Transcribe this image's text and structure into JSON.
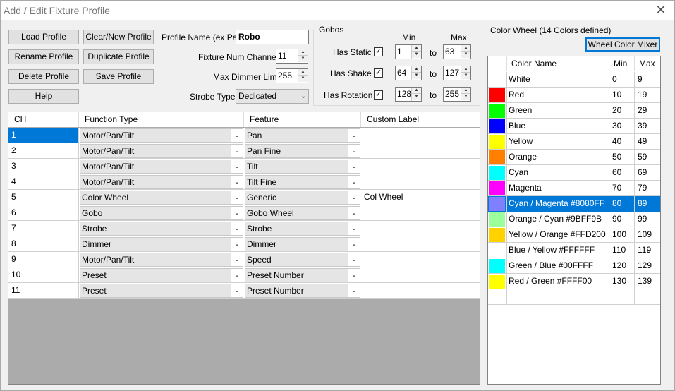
{
  "window": {
    "title": "Add / Edit Fixture Profile",
    "close_glyph": "✕"
  },
  "buttons": {
    "load_profile": "Load Profile",
    "clear_new_profile": "Clear/New Profile",
    "rename_profile": "Rename Profile",
    "duplicate_profile": "Duplicate Profile",
    "delete_profile": "Delete Profile",
    "save_profile": "Save Profile",
    "help": "Help",
    "wheel_color_mixer": "Wheel Color Mixer"
  },
  "profile": {
    "name_label": "Profile Name (ex Par)",
    "name_value": "Robo",
    "num_channels_label": "Fixture Num Channels",
    "num_channels_value": "11",
    "max_dimmer_label": "Max Dimmer Limit",
    "max_dimmer_value": "255",
    "strobe_type_label": "Strobe Type",
    "strobe_type_value": "Dedicated"
  },
  "gobos": {
    "title": "Gobos",
    "min_header": "Min",
    "max_header": "Max",
    "to_label": "to",
    "rows": [
      {
        "label": "Has Static",
        "checked": "✓",
        "min": "1",
        "max": "63"
      },
      {
        "label": "Has Shake",
        "checked": "✓",
        "min": "64",
        "max": "127"
      },
      {
        "label": "Has Rotation",
        "checked": "✓",
        "min": "128",
        "max": "255"
      }
    ]
  },
  "grid": {
    "headers": [
      "CH",
      "Function Type",
      "Feature",
      "Custom Label"
    ],
    "rows": [
      {
        "ch": "1",
        "function": "Motor/Pan/Tilt",
        "feature": "Pan",
        "label": ""
      },
      {
        "ch": "2",
        "function": "Motor/Pan/Tilt",
        "feature": "Pan Fine",
        "label": ""
      },
      {
        "ch": "3",
        "function": "Motor/Pan/Tilt",
        "feature": "Tilt",
        "label": ""
      },
      {
        "ch": "4",
        "function": "Motor/Pan/Tilt",
        "feature": "Tilt Fine",
        "label": ""
      },
      {
        "ch": "5",
        "function": "Color Wheel",
        "feature": "Generic",
        "label": "Col Wheel"
      },
      {
        "ch": "6",
        "function": "Gobo",
        "feature": "Gobo Wheel",
        "label": ""
      },
      {
        "ch": "7",
        "function": "Strobe",
        "feature": "Strobe",
        "label": ""
      },
      {
        "ch": "8",
        "function": "Dimmer",
        "feature": "Dimmer",
        "label": ""
      },
      {
        "ch": "9",
        "function": "Motor/Pan/Tilt",
        "feature": "Speed",
        "label": ""
      },
      {
        "ch": "10",
        "function": "Preset",
        "feature": "Preset Number",
        "label": ""
      },
      {
        "ch": "11",
        "function": "Preset",
        "feature": "Preset Number",
        "label": ""
      }
    ]
  },
  "color_wheel": {
    "title": "Color Wheel (14 Colors defined)",
    "headers": [
      "",
      "Color Name",
      "Min",
      "Max"
    ],
    "selected_index": 8,
    "rows": [
      {
        "color": "#FFFFFF",
        "name": "White",
        "min": "0",
        "max": "9"
      },
      {
        "color": "#FF0000",
        "name": "Red",
        "min": "10",
        "max": "19"
      },
      {
        "color": "#00FF00",
        "name": "Green",
        "min": "20",
        "max": "29"
      },
      {
        "color": "#0000FF",
        "name": "Blue",
        "min": "30",
        "max": "39"
      },
      {
        "color": "#FFFF00",
        "name": "Yellow",
        "min": "40",
        "max": "49"
      },
      {
        "color": "#FF8000",
        "name": "Orange",
        "min": "50",
        "max": "59"
      },
      {
        "color": "#00FFFF",
        "name": "Cyan",
        "min": "60",
        "max": "69"
      },
      {
        "color": "#FF00FF",
        "name": "Magenta",
        "min": "70",
        "max": "79"
      },
      {
        "color": "#8080FF",
        "name": "Cyan / Magenta #8080FF",
        "min": "80",
        "max": "89"
      },
      {
        "color": "#9BFF9B",
        "name": "Orange / Cyan #9BFF9B",
        "min": "90",
        "max": "99"
      },
      {
        "color": "#FFD200",
        "name": "Yellow / Orange #FFD200",
        "min": "100",
        "max": "109"
      },
      {
        "color": "#FFFFFF",
        "name": "Blue / Yellow #FFFFFF",
        "min": "110",
        "max": "119"
      },
      {
        "color": "#00FFFF",
        "name": "Green / Blue #00FFFF",
        "min": "120",
        "max": "129"
      },
      {
        "color": "#FFFF00",
        "name": "Red / Green #FFFF00",
        "min": "130",
        "max": "139"
      }
    ]
  }
}
